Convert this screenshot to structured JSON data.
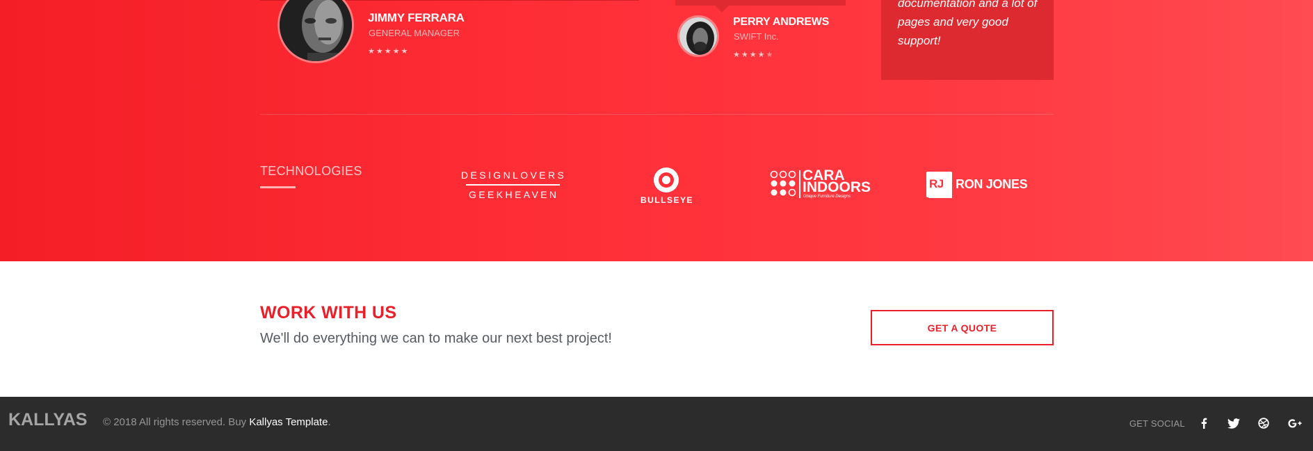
{
  "testimonials": [
    {
      "name": "JIMMY FERRARA",
      "role": "GENERAL MANAGER",
      "stars_on": "★★★★★",
      "stars_off": ""
    },
    {
      "name": "PERRY ANDREWS",
      "role": "SWIFT Inc.",
      "stars_on": "★★★★",
      "stars_off": "★"
    }
  ],
  "quote": {
    "text": "documentation and a lot of pages and very good support!"
  },
  "technologies": {
    "title": "TECHNOLOGIES",
    "logos": {
      "designlovers_top": "DESIGNLOVERS",
      "designlovers_bottom": "GEEKHEAVEN",
      "bullseye": "BULLSEYE",
      "cara_line1": "CARA",
      "cara_line2": "INDOORS",
      "cara_tagline": "Unique Furniture Designs",
      "ronjones_badge": "RJ",
      "ronjones_name": "RON JONES"
    }
  },
  "work": {
    "title": "WORK WITH US",
    "subtitle": "We'll do everything we can to make our next best project!",
    "button_label": "GET A QUOTE"
  },
  "footer": {
    "logo": "KALLYAS",
    "copyright": "© 2018 All rights reserved. Buy ",
    "link_label": "Kallyas Template",
    "trailing": ".",
    "get_social": "GET SOCIAL",
    "social_icons": [
      "facebook-icon",
      "twitter-icon",
      "dribbble-icon",
      "google-plus-icon"
    ]
  },
  "colors": {
    "accent": "#e8202a",
    "band": "#ff2f38",
    "footer_bg": "#2c2c2c"
  }
}
